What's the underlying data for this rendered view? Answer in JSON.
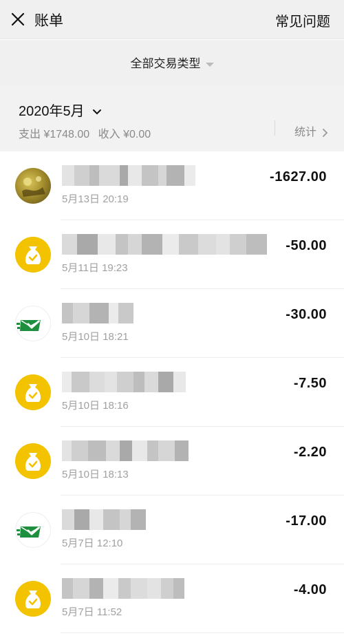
{
  "header": {
    "title": "账单",
    "help_link": "常见问题"
  },
  "filter": {
    "label": "全部交易类型"
  },
  "month": {
    "label": "2020年5月",
    "expense": "支出 ¥1748.00",
    "income": "收入 ¥0.00",
    "stats_label": "统计"
  },
  "transactions": [
    {
      "time": "5月13日 20:19",
      "amount": "-1627.00",
      "icon": "photo-avatar"
    },
    {
      "time": "5月11日 19:23",
      "amount": "-50.00",
      "icon": "money-bag-icon"
    },
    {
      "time": "5月10日 18:21",
      "amount": "-30.00",
      "icon": "envelope-check-icon"
    },
    {
      "time": "5月10日 18:16",
      "amount": "-7.50",
      "icon": "money-bag-icon"
    },
    {
      "time": "5月10日 18:13",
      "amount": "-2.20",
      "icon": "money-bag-icon"
    },
    {
      "time": "5月7日 12:10",
      "amount": "-17.00",
      "icon": "envelope-check-icon"
    },
    {
      "time": "5月7日 11:52",
      "amount": "-4.00",
      "icon": "money-bag-icon"
    }
  ],
  "colors": {
    "moneybag": "#f3c300",
    "envelope": "#1e8f3e",
    "header_bg": "#f0f0f0"
  }
}
